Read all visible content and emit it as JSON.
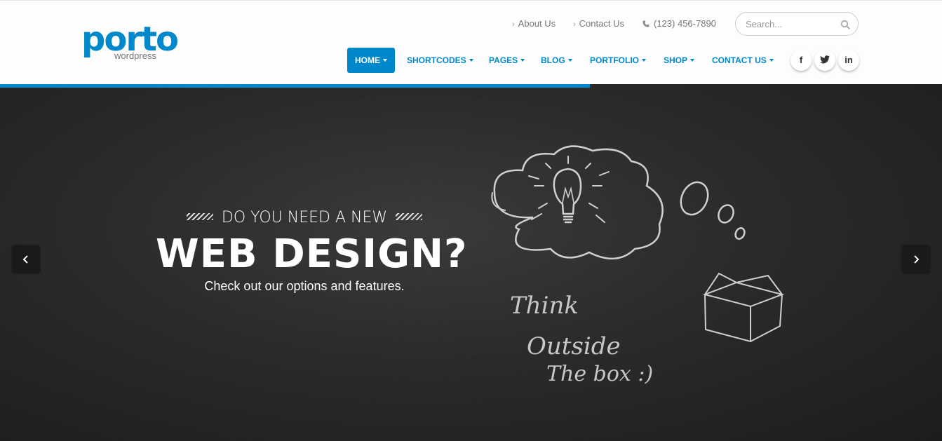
{
  "brand": {
    "name": "porto",
    "tagline": "wordpress",
    "accent": "#0088cc"
  },
  "top_links": {
    "about": "About Us",
    "contact": "Contact Us",
    "phone": "(123) 456-7890"
  },
  "search": {
    "placeholder": "Search..."
  },
  "nav": {
    "items": [
      {
        "label": "HOME",
        "active": true
      },
      {
        "label": "SHORTCODES"
      },
      {
        "label": "PAGES"
      },
      {
        "label": "BLOG"
      },
      {
        "label": "PORTFOLIO"
      },
      {
        "label": "SHOP"
      },
      {
        "label": "CONTACT US"
      }
    ]
  },
  "social": {
    "facebook": "f",
    "twitter": "twitter-icon",
    "linkedin": "in"
  },
  "slider": {
    "progress": 0.626,
    "kicker": "DO YOU NEED A NEW",
    "headline": "WEB DESIGN?",
    "subtext": "Check out our options and features.",
    "chalk": {
      "line1": "Think",
      "line2": "Outside",
      "line3": "The box :)"
    }
  }
}
